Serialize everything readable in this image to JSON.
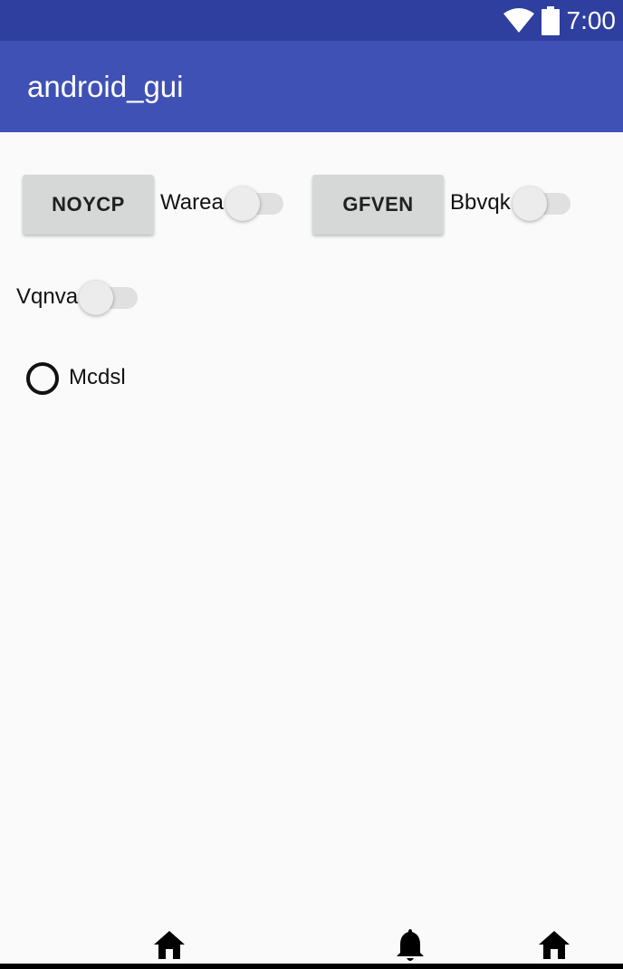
{
  "status_bar": {
    "time": "7:00",
    "icons": [
      "wifi-icon",
      "battery-icon"
    ]
  },
  "app_bar": {
    "title": "android_gui"
  },
  "content": {
    "button_1": "NOYCP",
    "switch_1_label": "Warea",
    "switch_1_on": false,
    "button_2": "GFVEN",
    "switch_2_label": "Bbvqk",
    "switch_2_on": false,
    "switch_3_label": "Vqnva",
    "switch_3_on": false,
    "radio_label": "Mcdsl",
    "radio_checked": false
  },
  "bottom_nav": {
    "icons": [
      "home-icon",
      "bell-icon",
      "home-icon"
    ]
  },
  "colors": {
    "status_bar": "#2e3f9f",
    "app_bar": "#3f51b5",
    "background": "#fafafa"
  }
}
